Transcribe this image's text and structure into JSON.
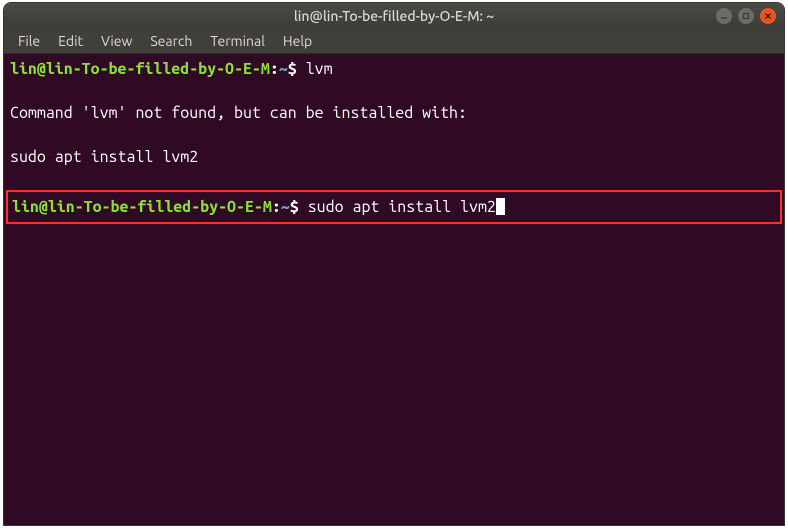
{
  "window": {
    "title": "lin@lin-To-be-filled-by-O-E-M: ~"
  },
  "menubar": {
    "file": "File",
    "edit": "Edit",
    "view": "View",
    "search": "Search",
    "terminal": "Terminal",
    "help": "Help"
  },
  "terminal": {
    "prompt_userhost": "lin@lin-To-be-filled-by-O-E-M",
    "prompt_sep1": ":",
    "prompt_path": "~",
    "prompt_sep2": "$ ",
    "line1_cmd": "lvm",
    "line2_output": "Command 'lvm' not found, but can be installed with:",
    "line3_output": "sudo apt install lvm2",
    "line4_cmd": "sudo apt install lvm2"
  }
}
